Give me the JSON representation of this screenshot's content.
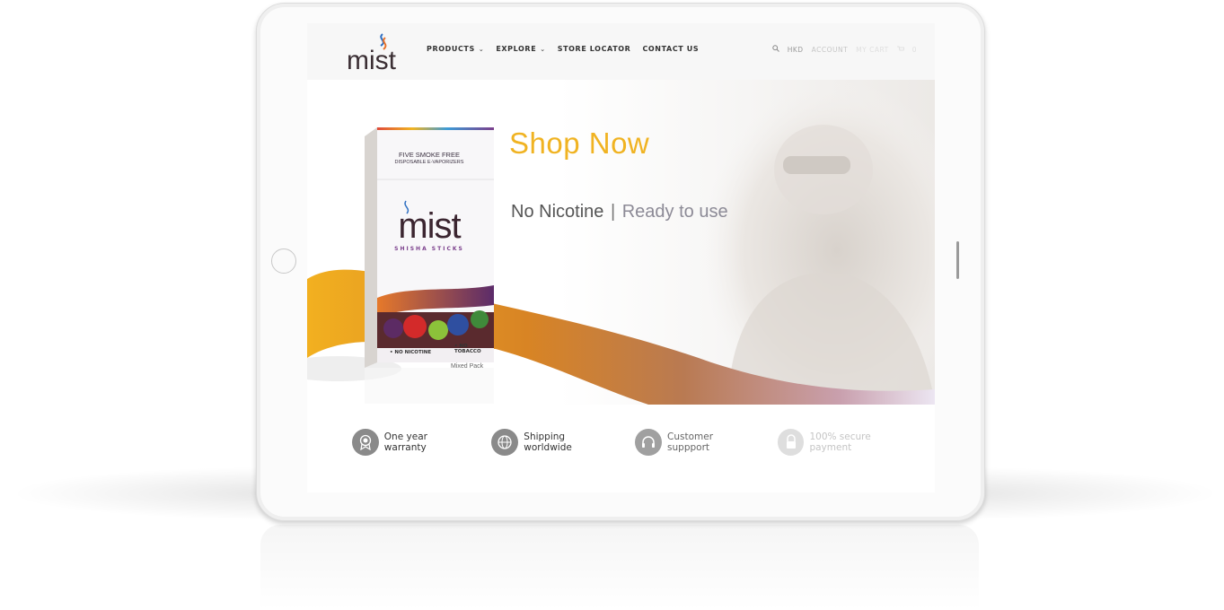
{
  "header": {
    "logo_text": "mist",
    "nav": [
      {
        "label": "PRODUCTS",
        "has_dropdown": true
      },
      {
        "label": "EXPLORE",
        "has_dropdown": true
      },
      {
        "label": "STORE LOCATOR",
        "has_dropdown": false
      },
      {
        "label": "CONTACT US",
        "has_dropdown": false
      }
    ],
    "utility": {
      "search_icon": "search-icon",
      "currency": "HKD",
      "account": "ACCOUNT",
      "cart": "MY CART",
      "cart_icon": "cart-icon",
      "cart_count": "0"
    }
  },
  "hero": {
    "headline": "Shop Now",
    "tagline_left": "No Nicotine",
    "tagline_sep": "|",
    "tagline_right": "Ready to use",
    "product": {
      "line1": "FIVE SMOKE FREE",
      "line2": "DISPOSABLE E-VAPORIZERS",
      "brand": "mist",
      "sub": "SHISHA STICKS",
      "badge_left": "• NO NICOTINE",
      "badge_right": "• NO TOBACCO",
      "variant": "Mixed Pack"
    }
  },
  "features": [
    {
      "icon": "award-icon",
      "label": "One year warranty"
    },
    {
      "icon": "globe-icon",
      "label": "Shipping worldwide"
    },
    {
      "icon": "headset-icon",
      "label": "Customer suppport"
    },
    {
      "icon": "lock-icon",
      "label": "100% secure payment"
    }
  ],
  "colors": {
    "accent_orange": "#f0b322",
    "brand_purple": "#7b3f8c",
    "text_dark": "#333333"
  }
}
